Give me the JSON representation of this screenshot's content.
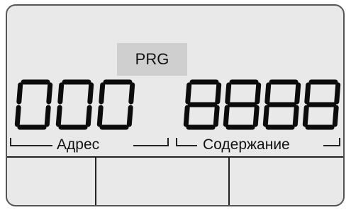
{
  "display": {
    "mode_indicator": "PRG",
    "address_digits": [
      "0",
      "0",
      "0"
    ],
    "content_digits": [
      "8",
      "8",
      "8",
      "8"
    ],
    "address_label": "Адрес",
    "content_label": "Содержание"
  }
}
